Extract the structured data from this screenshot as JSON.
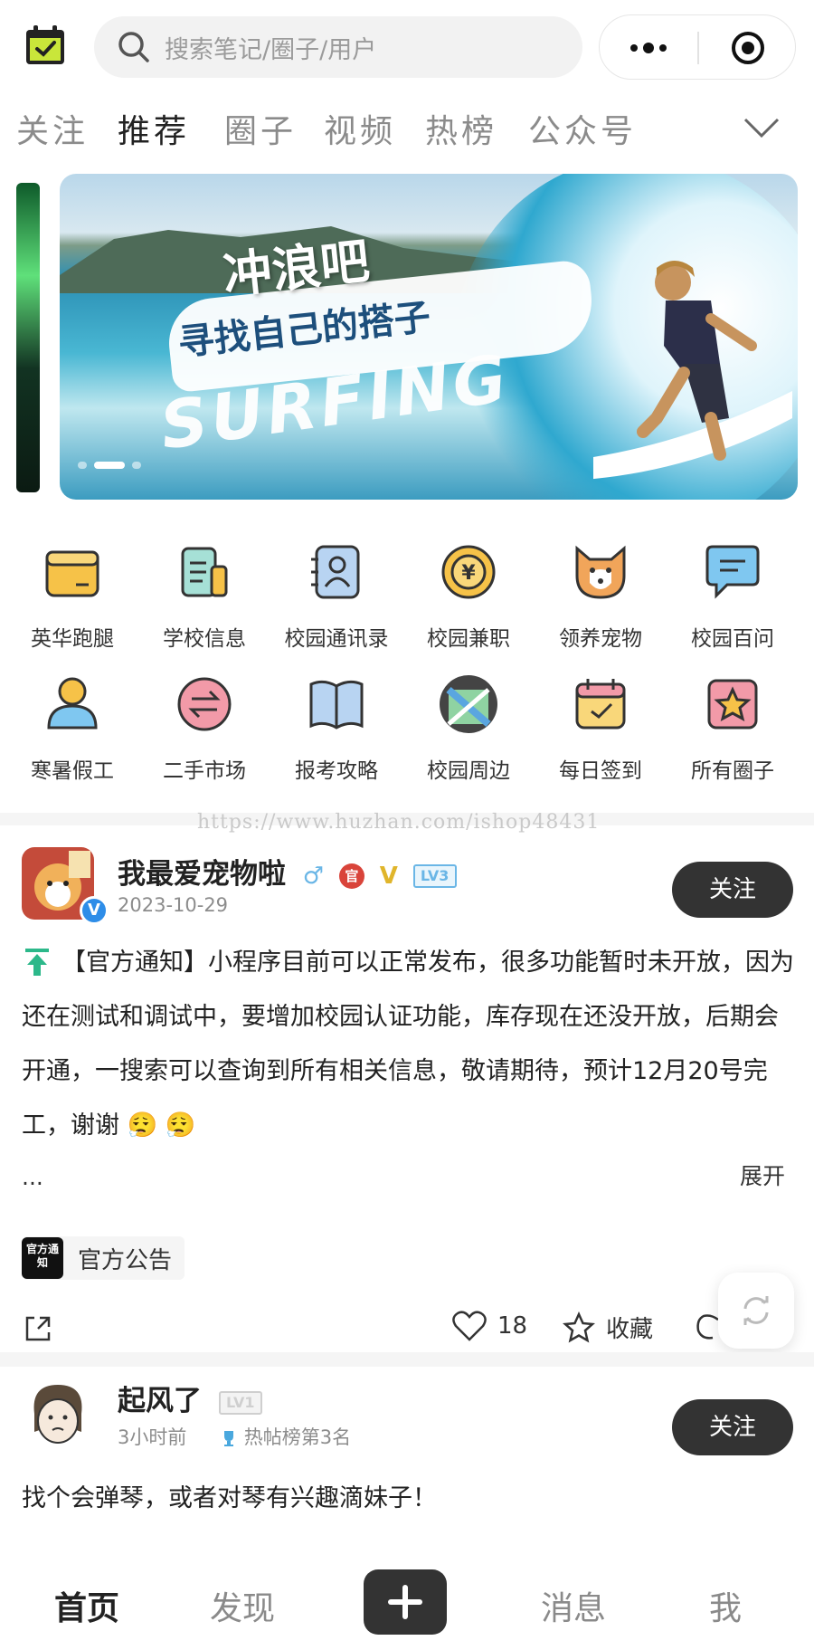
{
  "header": {
    "search_placeholder": "搜索笔记/圈子/用户",
    "logo_icon": "calendar-check-icon",
    "more_icon": "more-dots-icon",
    "close_icon": "target-close-icon"
  },
  "tabs": [
    {
      "label": "关注",
      "active": false
    },
    {
      "label": "推荐",
      "active": true
    },
    {
      "label": "圈子",
      "active": false
    },
    {
      "label": "视频",
      "active": false
    },
    {
      "label": "热榜",
      "active": false
    },
    {
      "label": "公众号",
      "active": false
    }
  ],
  "banner": {
    "line1": "冲浪吧",
    "line2": "寻找自己的搭子",
    "line3": "SURFING",
    "dot_count": 3,
    "active_dot": 2
  },
  "grid": [
    {
      "label": "英华跑腿",
      "icon": "folder-icon"
    },
    {
      "label": "学校信息",
      "icon": "document-icon"
    },
    {
      "label": "校园通讯录",
      "icon": "contacts-icon"
    },
    {
      "label": "校园兼职",
      "icon": "yuan-coin-icon"
    },
    {
      "label": "领养宠物",
      "icon": "dog-icon"
    },
    {
      "label": "校园百问",
      "icon": "chat-bubble-icon"
    },
    {
      "label": "寒暑假工",
      "icon": "user-icon"
    },
    {
      "label": "二手市场",
      "icon": "exchange-icon"
    },
    {
      "label": "报考攻略",
      "icon": "book-icon"
    },
    {
      "label": "校园周边",
      "icon": "map-icon"
    },
    {
      "label": "每日签到",
      "icon": "calendar-check-icon"
    },
    {
      "label": "所有圈子",
      "icon": "star-card-icon"
    }
  ],
  "watermark": "https://www.huzhan.com/ishop48431",
  "post1": {
    "username": "我最爱宠物啦",
    "gender_symbol": "♂",
    "official_badge": "官",
    "v_badge": "V",
    "level": "LV3",
    "verified": "V",
    "date": "2023-10-29",
    "follow_label": "关注",
    "content": "【官方通知】小程序目前可以正常发布，很多功能暂时未开放，因为还在测试和调试中，要增加校园认证功能，库存现在还没开放，后期会开通，一搜索可以查询到所有相关信息，敬请期待，预计12月20号完工，谢谢 😮‍💨 😮‍💨",
    "ellipsis": "...",
    "expand_label": "展开",
    "tag_icon_text": "官方通知",
    "tag_label": "官方公告",
    "likes": "18",
    "collect_label": "收藏"
  },
  "post2": {
    "username": "起风了",
    "level": "LV1",
    "time": "3小时前",
    "hot_rank": "热帖榜第3名",
    "follow_label": "关注",
    "content": "找个会弹琴，或者对琴有兴趣滴妹子！"
  },
  "bottom_nav": [
    {
      "label": "首页",
      "active": true
    },
    {
      "label": "发现",
      "active": false
    },
    {
      "label": "消息",
      "active": false
    },
    {
      "label": "我",
      "active": false
    }
  ],
  "colors": {
    "dark_button": "#333333",
    "level_blue": "#6ab6e6",
    "verified_blue": "#2e8de8"
  }
}
